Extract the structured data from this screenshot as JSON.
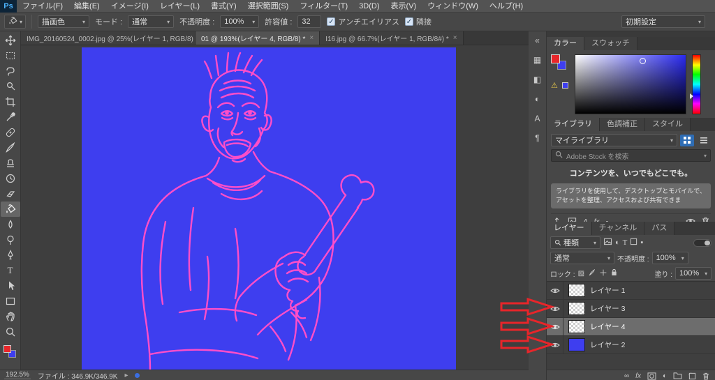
{
  "app": {
    "logo": "Ps"
  },
  "menubar": {
    "items": [
      "ファイル(F)",
      "編集(E)",
      "イメージ(I)",
      "レイヤー(L)",
      "書式(Y)",
      "選択範囲(S)",
      "フィルター(T)",
      "3D(D)",
      "表示(V)",
      "ウィンドウ(W)",
      "ヘルプ(H)"
    ]
  },
  "options": {
    "fill_source": "描画色",
    "mode_label": "モード :",
    "mode_value": "通常",
    "opacity_label": "不透明度 :",
    "opacity_value": "100%",
    "tolerance_label": "許容値 :",
    "tolerance_value": "32",
    "antialias_label": "アンチエイリアス",
    "contiguous_label": "隣接",
    "workspace": "初期設定"
  },
  "tabs": {
    "tab1": "IMG_20160524_0002.jpg @ 25%(レイヤー 1, RGB/8) *",
    "tab2": "01 @ 193%(レイヤー 4, RGB/8) *",
    "tab3": "I16.jpg @ 66.7%(レイヤー 1, RGB/8#) *"
  },
  "color_panel": {
    "tab_color": "カラー",
    "tab_swatches": "スウォッチ"
  },
  "libraries_panel": {
    "tab_libraries": "ライブラリ",
    "tab_adjustments": "色調補正",
    "tab_styles": "スタイル",
    "library_select": "マイライブラリ",
    "search_placeholder": "Adobe Stock を検索",
    "promo_title": "コンテンツを、いつでもどこでも。",
    "promo_body": "ライブラリを使用して、デスクトップとモバイルで、アセットを整理、アクセスおよび共有できま"
  },
  "layers_panel": {
    "tab_layers": "レイヤー",
    "tab_channels": "チャンネル",
    "tab_paths": "パス",
    "filter_label": "種類",
    "blend_mode": "通常",
    "opacity_label": "不透明度 :",
    "opacity_value": "100%",
    "lock_label": "ロック :",
    "fill_label": "塗り :",
    "fill_value": "100%",
    "layers": {
      "0": {
        "name": "レイヤー 1"
      },
      "1": {
        "name": "レイヤー 3"
      },
      "2": {
        "name": "レイヤー 4"
      },
      "3": {
        "name": "レイヤー 2"
      }
    }
  },
  "statusbar": {
    "zoom": "192.5%",
    "file_info": "ファイル : 346.9K/346.9K"
  },
  "icons": {
    "caret": "▾",
    "check": "✓",
    "close": "×",
    "collapse": "«",
    "warning": "⚠",
    "type_tool": "T",
    "fx": "fx",
    "character_panel": "A",
    "paragraph_panel": "¶",
    "histogram_panel": "▦",
    "properties_panel": "◧",
    "info_panel": "◐",
    "adjustment": "◐",
    "chip": "▪",
    "chevron": "▸",
    "checker_lock": "▨",
    "infinity_link": "∞"
  },
  "colors": {
    "canvas_blue": "#3e3eef",
    "drawing_pink": "#ff4ec9",
    "foreground_red": "#e8262a",
    "background_blue": "#3e3eef",
    "annotation_red": "#e8252a"
  }
}
